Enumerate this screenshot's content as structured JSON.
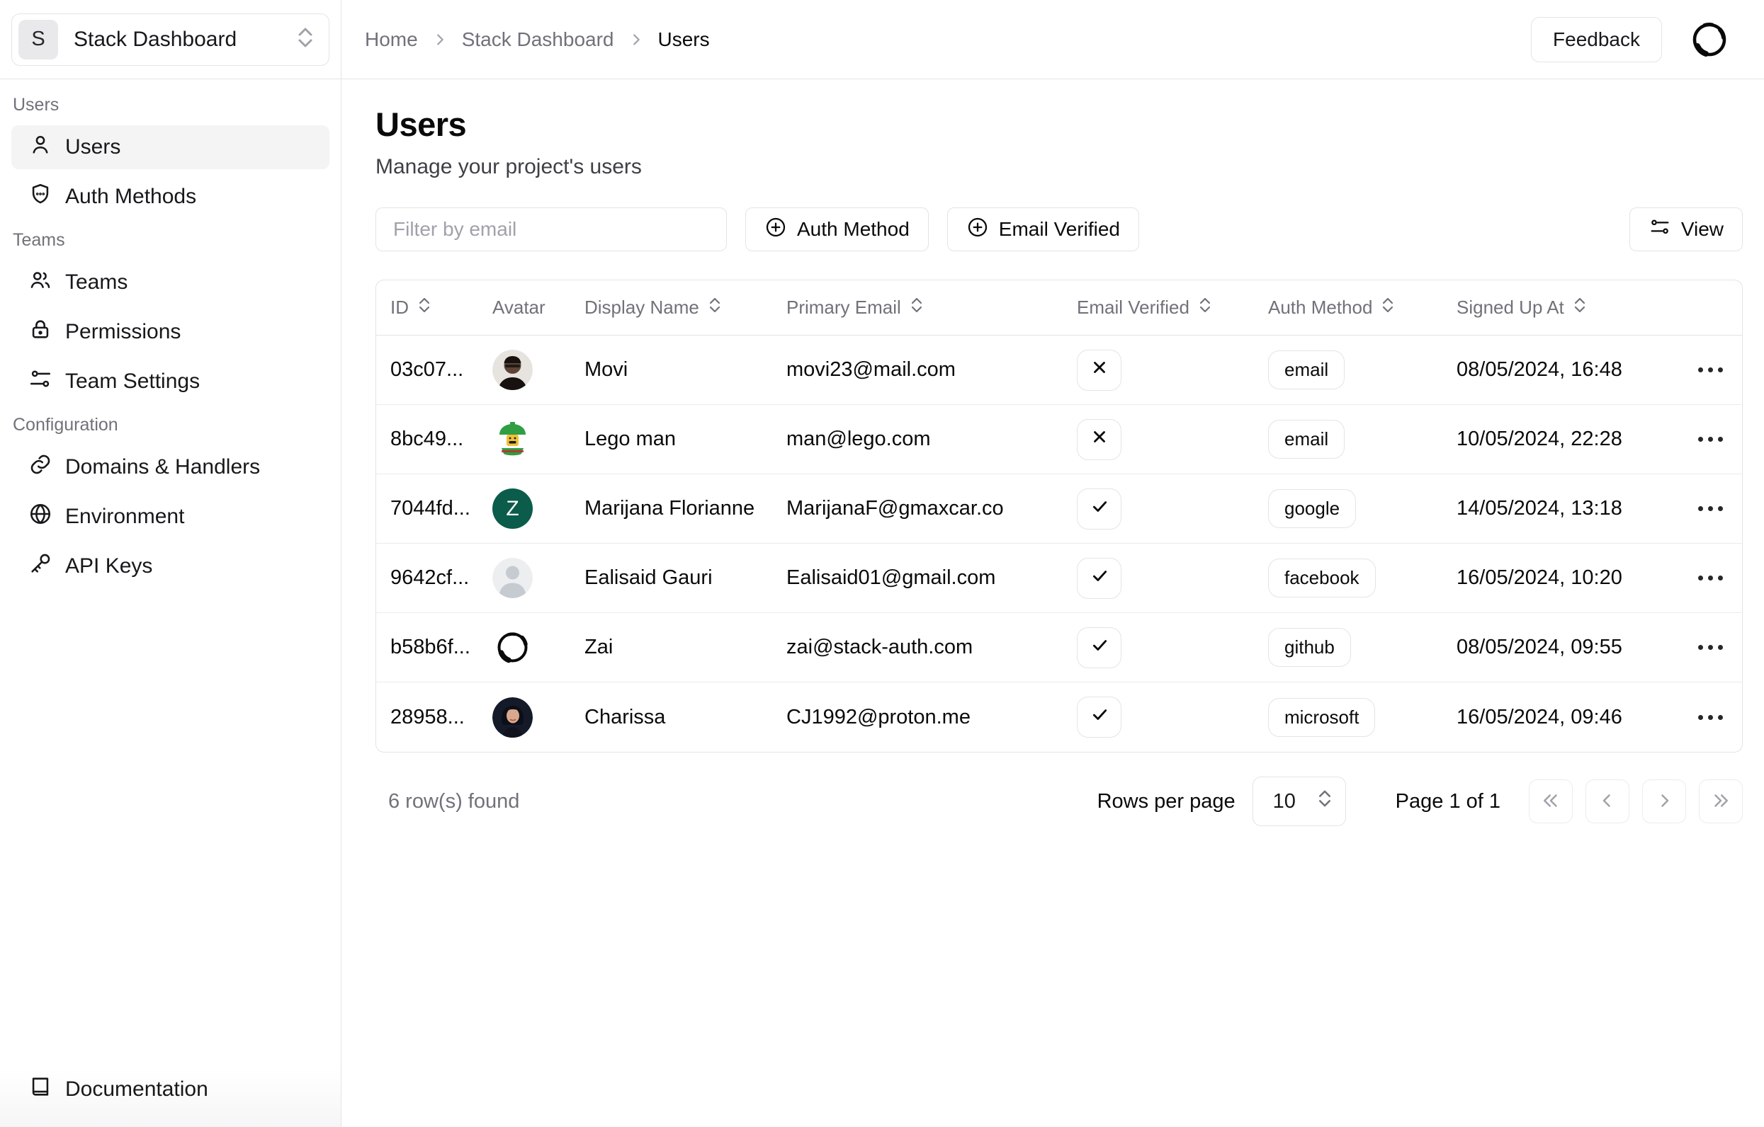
{
  "app": {
    "name": "Stack Dashboard",
    "logo_letter": "S"
  },
  "breadcrumb": {
    "items": [
      "Home",
      "Stack Dashboard",
      "Users"
    ]
  },
  "topbar": {
    "feedback_label": "Feedback"
  },
  "sidebar": {
    "sections": [
      {
        "label": "Users",
        "items": [
          {
            "label": "Users",
            "icon": "user-icon",
            "active": true
          },
          {
            "label": "Auth Methods",
            "icon": "shield-icon",
            "active": false
          }
        ]
      },
      {
        "label": "Teams",
        "items": [
          {
            "label": "Teams",
            "icon": "people-icon",
            "active": false
          },
          {
            "label": "Permissions",
            "icon": "lock-icon",
            "active": false
          },
          {
            "label": "Team Settings",
            "icon": "sliders-icon",
            "active": false
          }
        ]
      },
      {
        "label": "Configuration",
        "items": [
          {
            "label": "Domains & Handlers",
            "icon": "link-icon",
            "active": false
          },
          {
            "label": "Environment",
            "icon": "globe-icon",
            "active": false
          },
          {
            "label": "API Keys",
            "icon": "key-icon",
            "active": false
          }
        ]
      }
    ],
    "footer_item": {
      "label": "Documentation",
      "icon": "book-icon"
    }
  },
  "page": {
    "title": "Users",
    "subtitle": "Manage your project's users"
  },
  "toolbar": {
    "filter_placeholder": "Filter by email",
    "auth_method_label": "Auth Method",
    "email_verified_label": "Email Verified",
    "view_label": "View"
  },
  "table": {
    "columns": [
      {
        "label": "ID",
        "sortable": true
      },
      {
        "label": "Avatar",
        "sortable": false
      },
      {
        "label": "Display Name",
        "sortable": true
      },
      {
        "label": "Primary Email",
        "sortable": true
      },
      {
        "label": "Email Verified",
        "sortable": true
      },
      {
        "label": "Auth Method",
        "sortable": true
      },
      {
        "label": "Signed Up At",
        "sortable": true
      }
    ],
    "rows": [
      {
        "id": "03c07...",
        "avatar": "photo-man-glasses",
        "display_name": "Movi",
        "primary_email": "movi23@mail.com",
        "email_verified": false,
        "auth_method": "email",
        "signed_up_at": "08/05/2024, 16:48"
      },
      {
        "id": "8bc49...",
        "avatar": "lego-figure",
        "display_name": "Lego man",
        "primary_email": "man@lego.com",
        "email_verified": false,
        "auth_method": "email",
        "signed_up_at": "10/05/2024, 22:28"
      },
      {
        "id": "7044fd...",
        "avatar": "letter-avatar",
        "avatar_letter": "Z",
        "avatar_color": "#0b5c4b",
        "display_name": "Marijana Florianne",
        "primary_email": "MarijanaF@gmaxcar.co",
        "email_verified": true,
        "auth_method": "google",
        "signed_up_at": "14/05/2024, 13:18"
      },
      {
        "id": "9642cf...",
        "avatar": "placeholder-silhouette",
        "display_name": "Ealisaid Gauri",
        "primary_email": "Ealisaid01@gmail.com",
        "email_verified": true,
        "auth_method": "facebook",
        "signed_up_at": "16/05/2024, 10:20"
      },
      {
        "id": "b58b6f...",
        "avatar": "ink-ring-sketch",
        "display_name": "Zai",
        "primary_email": "zai@stack-auth.com",
        "email_verified": true,
        "auth_method": "github",
        "signed_up_at": "08/05/2024, 09:55"
      },
      {
        "id": "28958...",
        "avatar": "photo-woman",
        "display_name": "Charissa",
        "primary_email": "CJ1992@proton.me",
        "email_verified": true,
        "auth_method": "microsoft",
        "signed_up_at": "16/05/2024, 09:46"
      }
    ]
  },
  "footer": {
    "rows_found": "6 row(s) found",
    "rows_per_page_label": "Rows per page",
    "rows_per_page_value": "10",
    "page_label": "Page 1 of 1"
  },
  "colors": {
    "border": "#e4e4e7",
    "muted_text": "#71717a",
    "active_item_bg": "#f4f4f5"
  }
}
